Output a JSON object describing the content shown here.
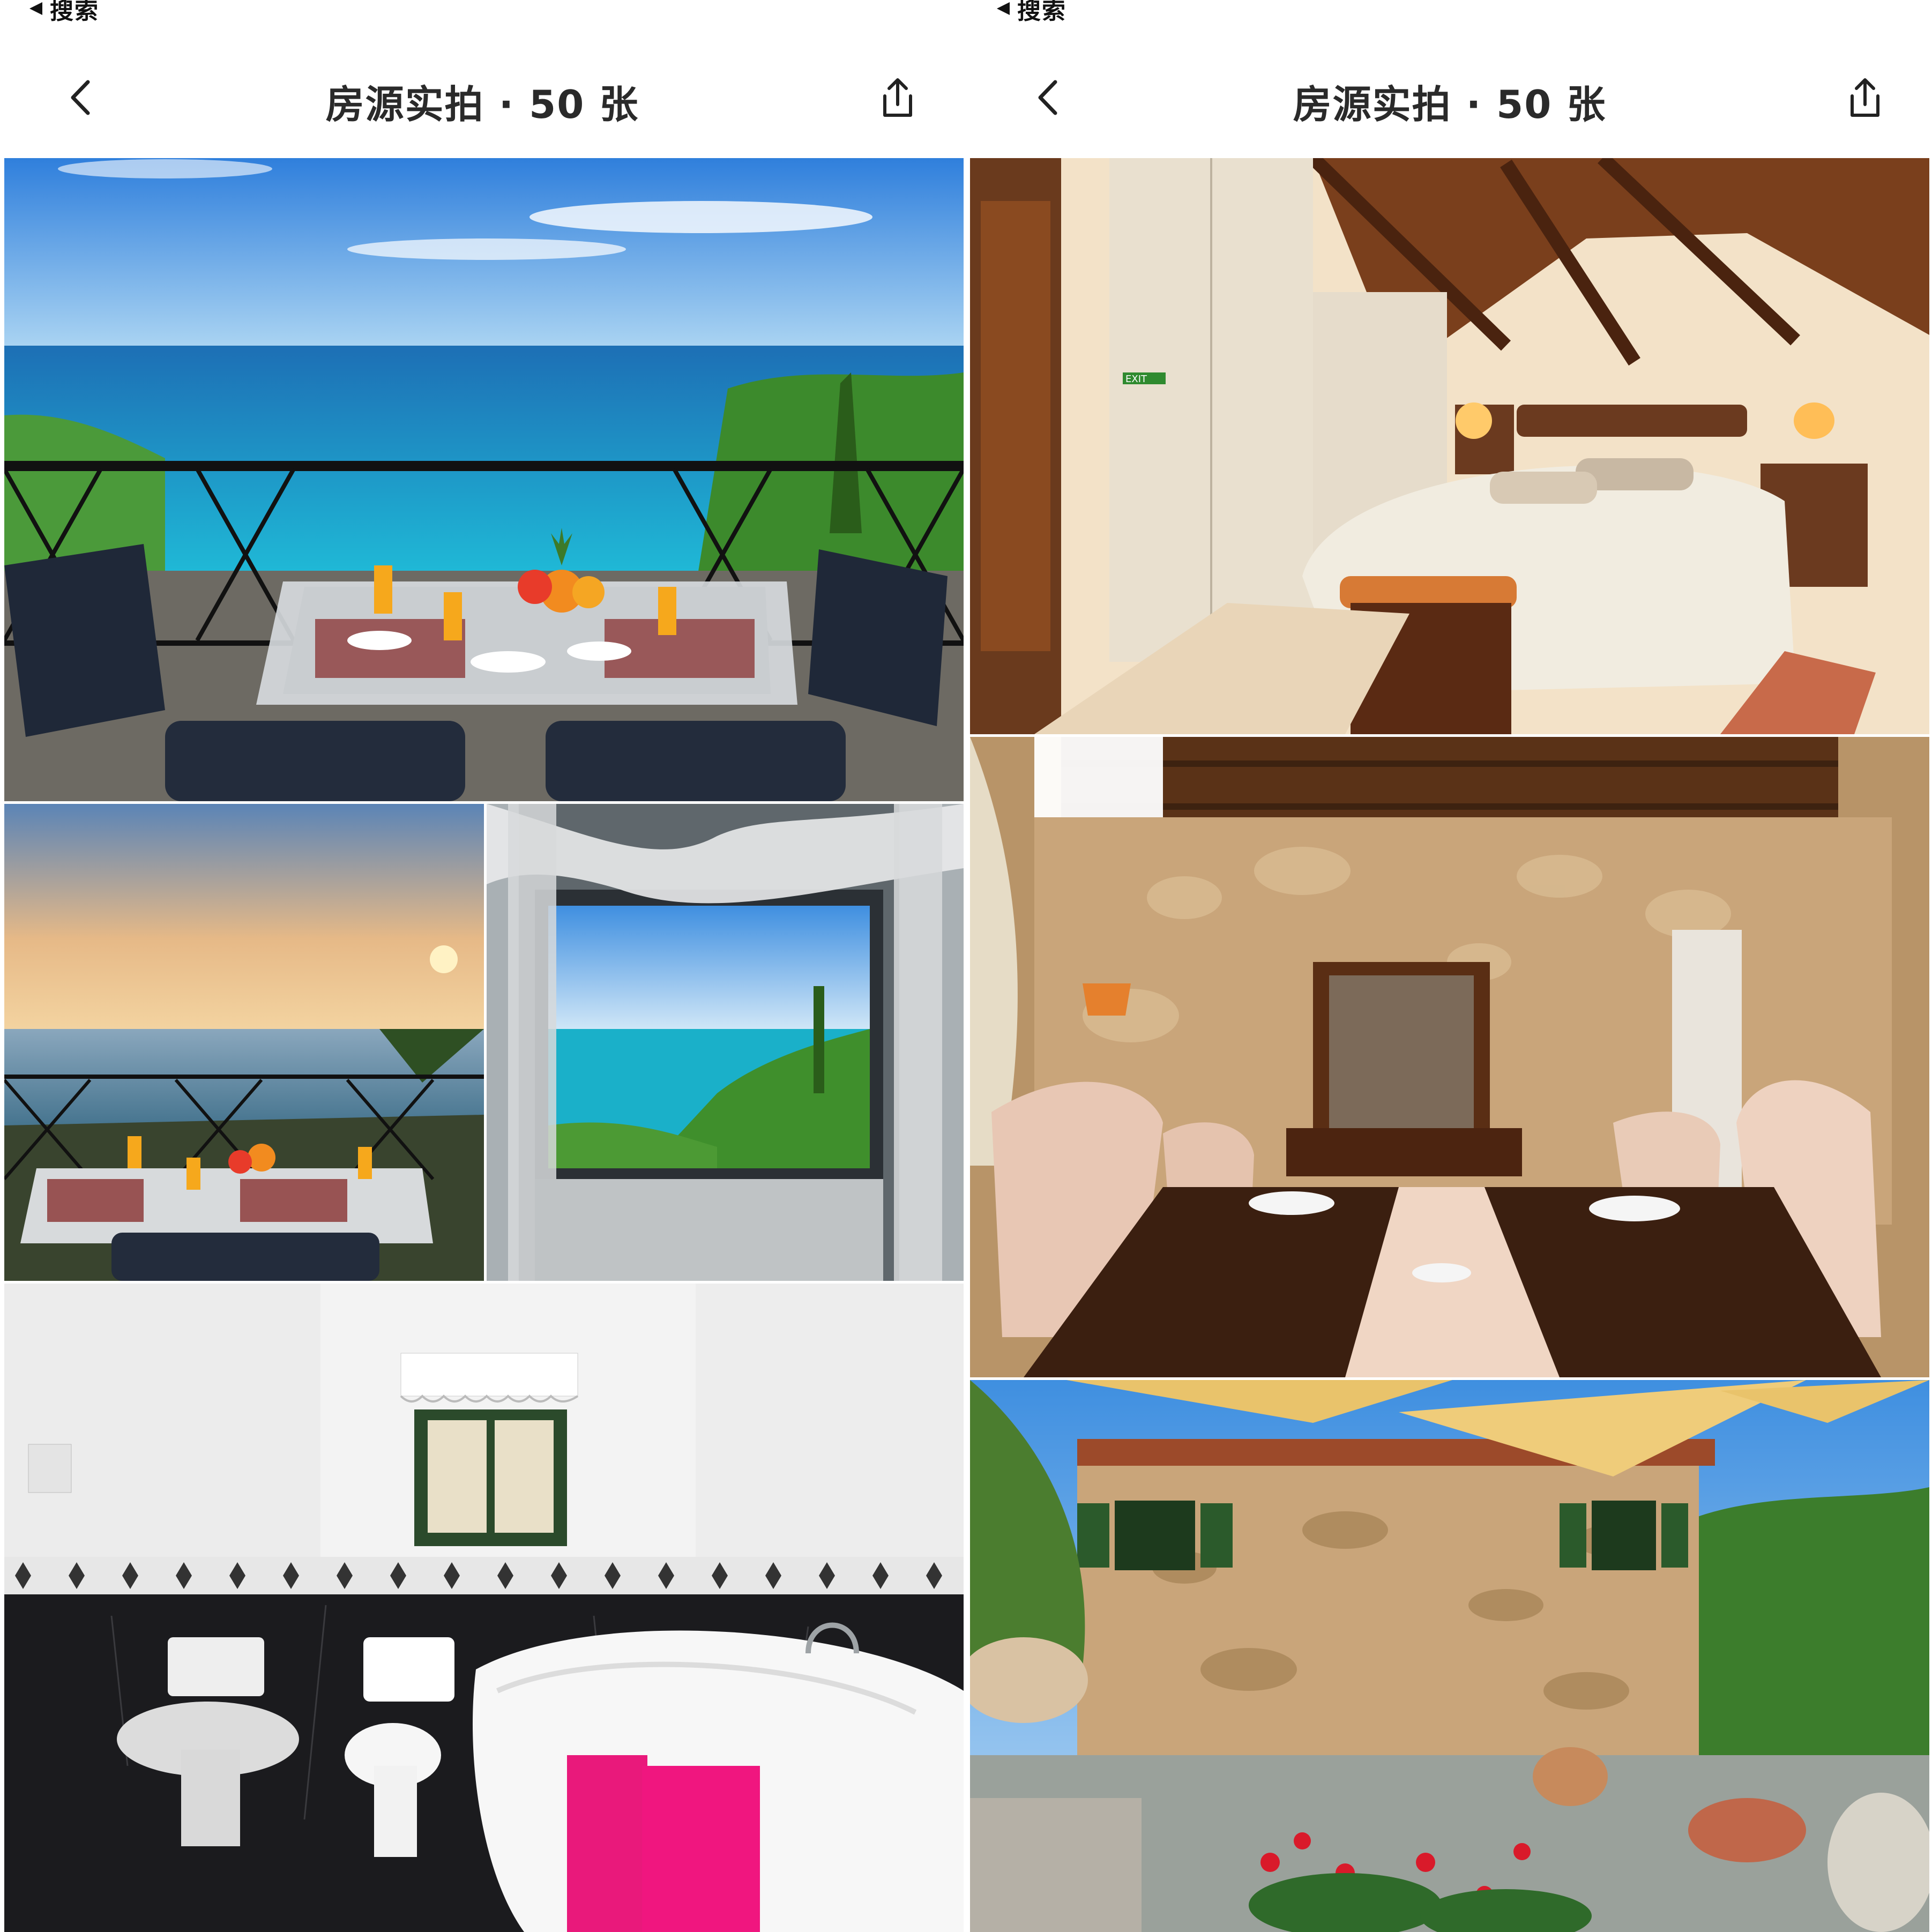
{
  "screens": [
    {
      "status_back_label": "搜索",
      "header": {
        "title": "房源实拍 · 50 张"
      },
      "icons": {
        "back": "chevron-left-icon",
        "share": "share-icon"
      }
    },
    {
      "status_back_label": "搜索",
      "header": {
        "title": "房源实拍 · 50 张"
      },
      "icons": {
        "back": "chevron-left-icon",
        "share": "share-icon"
      }
    }
  ],
  "photos": {
    "left": [
      "balcony-breakfast-sea-view",
      "sunset-balcony-breakfast",
      "window-sea-view",
      "marble-bathroom"
    ],
    "right": [
      "attic-bedroom",
      "stone-wall-dining-room",
      "stone-house-garden-patio"
    ]
  },
  "sign_text": "EXIT",
  "colors": {
    "sea": "#19a6c8",
    "sky": "#3f8fe0",
    "wood": "#6b3a1f",
    "stone": "#c9a57a"
  }
}
